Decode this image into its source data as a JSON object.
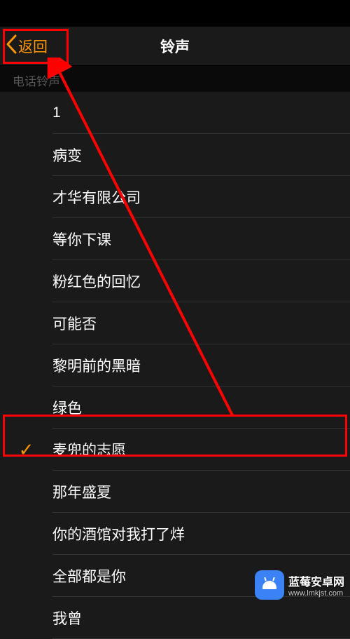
{
  "nav": {
    "back_label": "返回",
    "title": "铃声"
  },
  "section_header": "电话铃声",
  "ringtones": [
    {
      "label": "1",
      "selected": false
    },
    {
      "label": "病变",
      "selected": false
    },
    {
      "label": "才华有限公司",
      "selected": false
    },
    {
      "label": "等你下课",
      "selected": false
    },
    {
      "label": "粉红色的回忆",
      "selected": false
    },
    {
      "label": "可能否",
      "selected": false
    },
    {
      "label": "黎明前的黑暗",
      "selected": false
    },
    {
      "label": "绿色",
      "selected": false
    },
    {
      "label": "麦兜的志愿",
      "selected": true
    },
    {
      "label": "那年盛夏",
      "selected": false
    },
    {
      "label": "你的酒馆对我打了烊",
      "selected": false
    },
    {
      "label": "全部都是你",
      "selected": false
    },
    {
      "label": "我曾",
      "selected": false
    }
  ],
  "watermark": {
    "main": "蓝莓安卓网",
    "url": "www.lmkjst.com"
  },
  "colors": {
    "accent": "#FF9500",
    "annotation": "#ff0000"
  }
}
